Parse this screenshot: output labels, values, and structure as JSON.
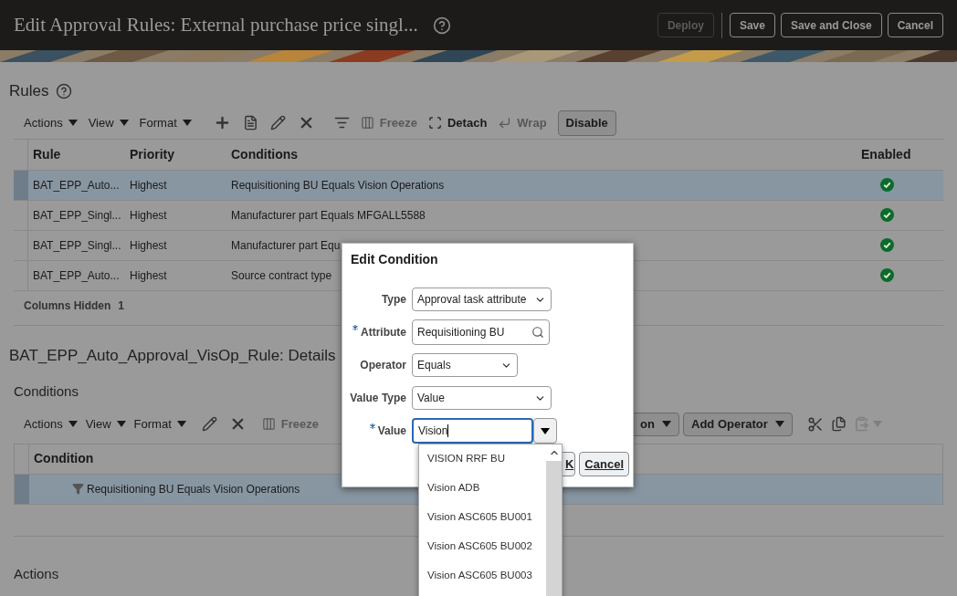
{
  "header": {
    "title": "Edit Approval Rules: External purchase price singl...",
    "buttons": [
      {
        "label": "Deploy",
        "disabled": true
      },
      {
        "label": "Save",
        "disabled": false
      },
      {
        "label": "Save and Close",
        "disabled": false
      },
      {
        "label": "Cancel",
        "disabled": false
      }
    ]
  },
  "rules": {
    "title": "Rules",
    "toolbar": {
      "menus": [
        "Actions",
        "View",
        "Format"
      ],
      "text_tools": [
        {
          "label": "Freeze",
          "disabled": true
        },
        {
          "label": "Detach",
          "disabled": false
        },
        {
          "label": "Wrap",
          "disabled": true
        }
      ],
      "button": "Disable"
    },
    "table": {
      "columns": [
        "Rule",
        "Priority",
        "Conditions",
        "Enabled"
      ],
      "rows": [
        {
          "rule": "BAT_EPP_Auto...",
          "priority": "Highest",
          "conditions": "Requisitioning BU Equals Vision Operations",
          "enabled": true,
          "selected": true
        },
        {
          "rule": "BAT_EPP_Singl...",
          "priority": "Highest",
          "conditions": "Manufacturer part Equals MFGALL5588",
          "enabled": true,
          "selected": false
        },
        {
          "rule": "BAT_EPP_Singl...",
          "priority": "Highest",
          "conditions": "Manufacturer part Equ",
          "enabled": true,
          "selected": false
        },
        {
          "rule": "BAT_EPP_Auto...",
          "priority": "Highest",
          "conditions": "Source contract type",
          "enabled": true,
          "selected": false
        }
      ]
    },
    "columns_hidden": {
      "label": "Columns Hidden",
      "count": "1"
    }
  },
  "details": {
    "title": "BAT_EPP_Auto_Approval_VisOp_Rule: Details",
    "conditions_title": "Conditions",
    "toolbar": {
      "menus": [
        "Actions",
        "View",
        "Format"
      ],
      "freeze": {
        "label": "Freeze",
        "disabled": true
      },
      "buttons": [
        "on",
        "Add Operator"
      ]
    },
    "table": {
      "column": "Condition",
      "rows": [
        {
          "text": "Requisitioning BU Equals Vision Operations",
          "selected": true
        }
      ]
    },
    "actions_title": "Actions"
  },
  "dialog": {
    "title": "Edit Condition",
    "fields": [
      {
        "label": "Type",
        "required": false,
        "kind": "select",
        "value": "Approval task attribute"
      },
      {
        "label": "Attribute",
        "required": true,
        "kind": "search",
        "value": "Requisitioning BU"
      },
      {
        "label": "Operator",
        "required": false,
        "kind": "select",
        "value": "Equals"
      },
      {
        "label": "Value Type",
        "required": false,
        "kind": "select",
        "value": "Value"
      },
      {
        "label": "Value",
        "required": true,
        "kind": "combo",
        "value": "Vision"
      }
    ],
    "buttons": [
      "K",
      "Cancel"
    ],
    "options": [
      "VISION RRF BU",
      "Vision ADB",
      "Vision ASC605 BU001",
      "Vision ASC605 BU002",
      "Vision ASC605 BU003"
    ]
  }
}
